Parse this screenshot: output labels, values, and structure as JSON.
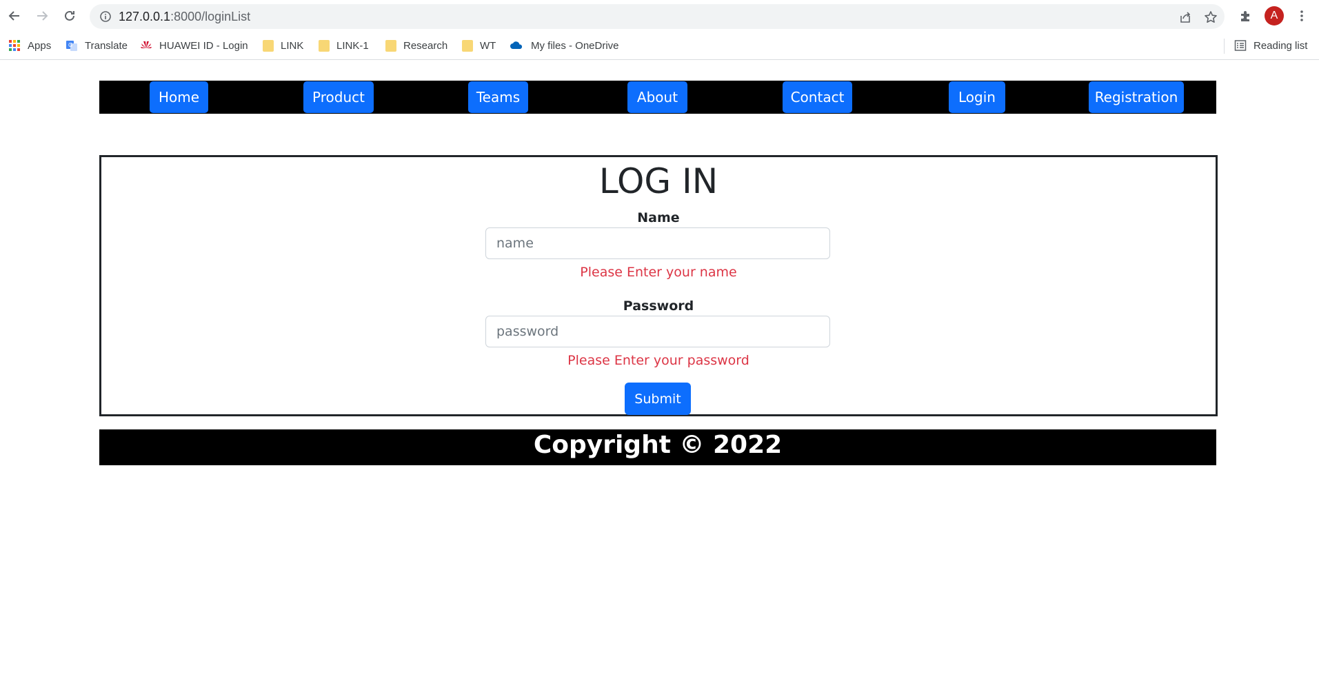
{
  "browser": {
    "url_host": "127.0.0.1",
    "url_rest": ":8000/loginList",
    "avatar_letter": "A",
    "bookmarks": [
      {
        "label": "Apps",
        "icon": "apps-grid-icon"
      },
      {
        "label": "Translate",
        "icon": "google-translate-icon"
      },
      {
        "label": "HUAWEI ID - Login",
        "icon": "huawei-logo-icon"
      },
      {
        "label": "LINK",
        "icon": "folder-icon"
      },
      {
        "label": "LINK-1",
        "icon": "folder-icon"
      },
      {
        "label": "Research",
        "icon": "folder-icon"
      },
      {
        "label": "WT",
        "icon": "folder-icon"
      },
      {
        "label": "My files - OneDrive",
        "icon": "onedrive-cloud-icon"
      }
    ],
    "reading_list": "Reading list"
  },
  "nav": {
    "items": [
      "Home",
      "Product",
      "Teams",
      "About",
      "Contact",
      "Login",
      "Registration"
    ]
  },
  "form": {
    "title": "LOG IN",
    "name_label": "Name",
    "name_placeholder": "name",
    "name_error": "Please Enter your name",
    "password_label": "Password",
    "password_placeholder": "password",
    "password_error": "Please Enter your password",
    "submit_label": "Submit"
  },
  "footer": {
    "text": "Copyright © 2022"
  },
  "colors": {
    "primary": "#0d6efd",
    "error": "#dc3545",
    "nav_bg": "#000000",
    "avatar": "#c5221f"
  }
}
